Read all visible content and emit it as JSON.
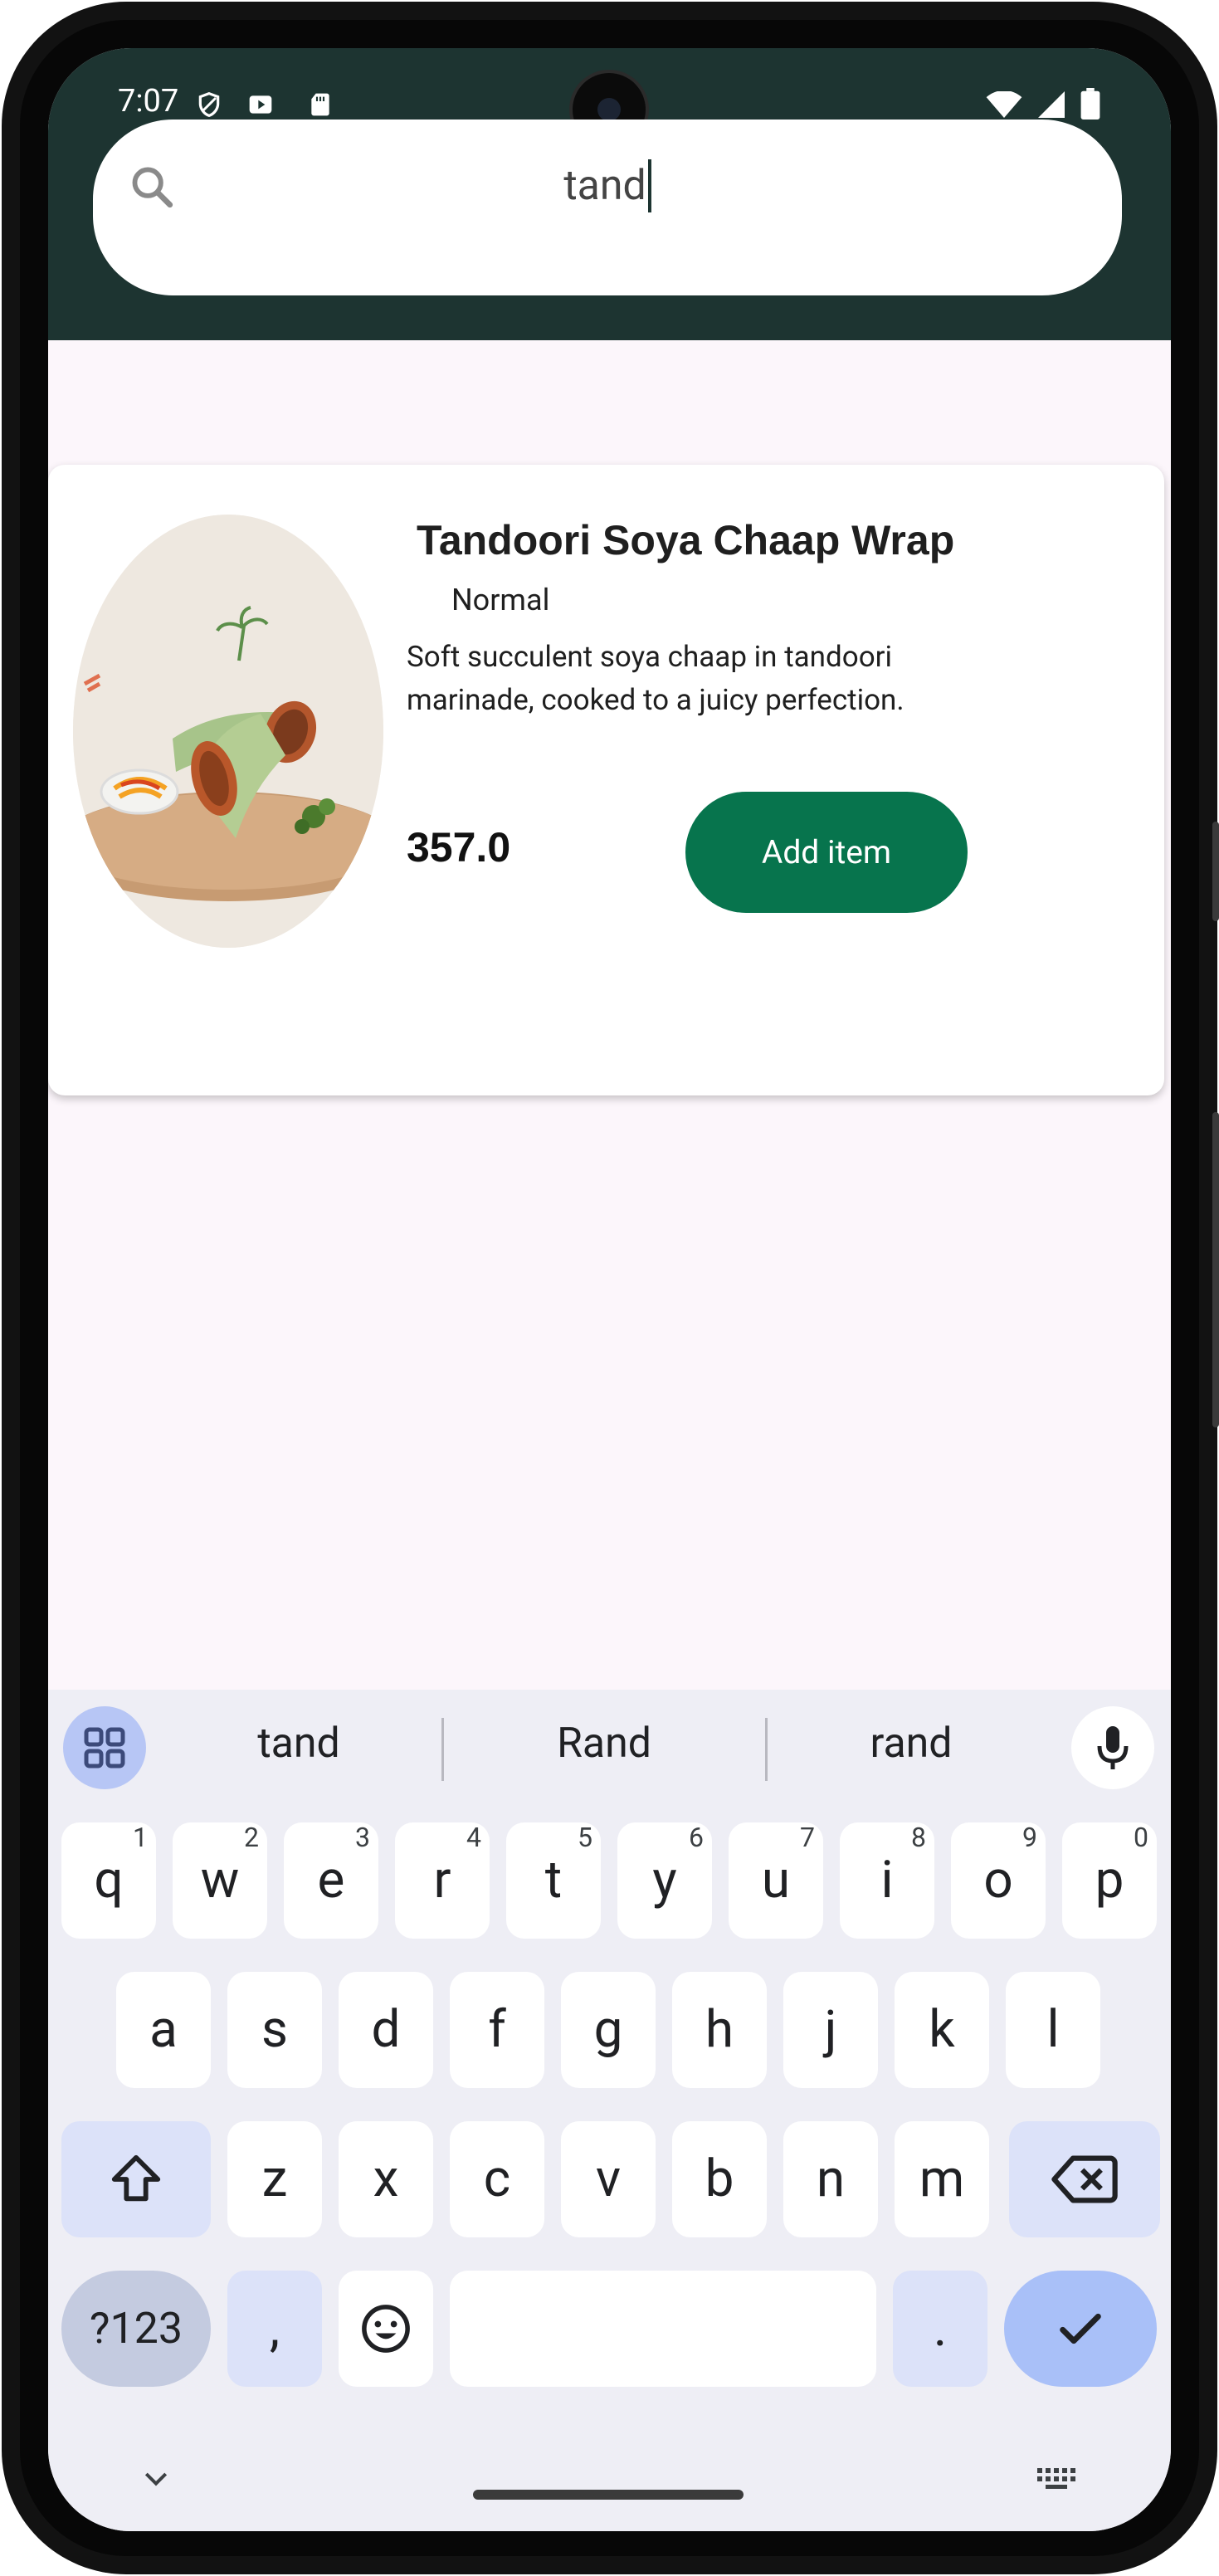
{
  "status_bar": {
    "time": "7:07"
  },
  "search": {
    "value": "tand"
  },
  "results": [
    {
      "title": "Tandoori Soya Chaap Wrap",
      "variant": "Normal",
      "description": "Soft succulent soya chaap in tandoori marinade, cooked to a juicy perfection.",
      "price": "357.0",
      "button_label": "Add item"
    }
  ],
  "keyboard": {
    "suggestions": [
      "tand",
      "Rand",
      "rand"
    ],
    "row1": [
      {
        "key": "q",
        "hint": "1"
      },
      {
        "key": "w",
        "hint": "2"
      },
      {
        "key": "e",
        "hint": "3"
      },
      {
        "key": "r",
        "hint": "4"
      },
      {
        "key": "t",
        "hint": "5"
      },
      {
        "key": "y",
        "hint": "6"
      },
      {
        "key": "u",
        "hint": "7"
      },
      {
        "key": "i",
        "hint": "8"
      },
      {
        "key": "o",
        "hint": "9"
      },
      {
        "key": "p",
        "hint": "0"
      }
    ],
    "row2": [
      "a",
      "s",
      "d",
      "f",
      "g",
      "h",
      "j",
      "k",
      "l"
    ],
    "row3": [
      "z",
      "x",
      "c",
      "v",
      "b",
      "n",
      "m"
    ],
    "symbols_label": "?123",
    "comma_label": ",",
    "period_label": "."
  },
  "colors": {
    "header": "#1d3431",
    "accent_button": "#07744d",
    "background": "#fcf6fb",
    "keyboard_bg": "#eeeef5"
  },
  "icons": {
    "search": "search-icon",
    "apps": "apps-grid-icon",
    "mic": "microphone-icon",
    "shift": "shift-icon",
    "backspace": "backspace-icon",
    "emoji": "emoji-icon",
    "enter": "checkmark-icon",
    "hide_keyboard": "chevron-down-icon",
    "keyboard_switch": "keyboard-icon"
  }
}
